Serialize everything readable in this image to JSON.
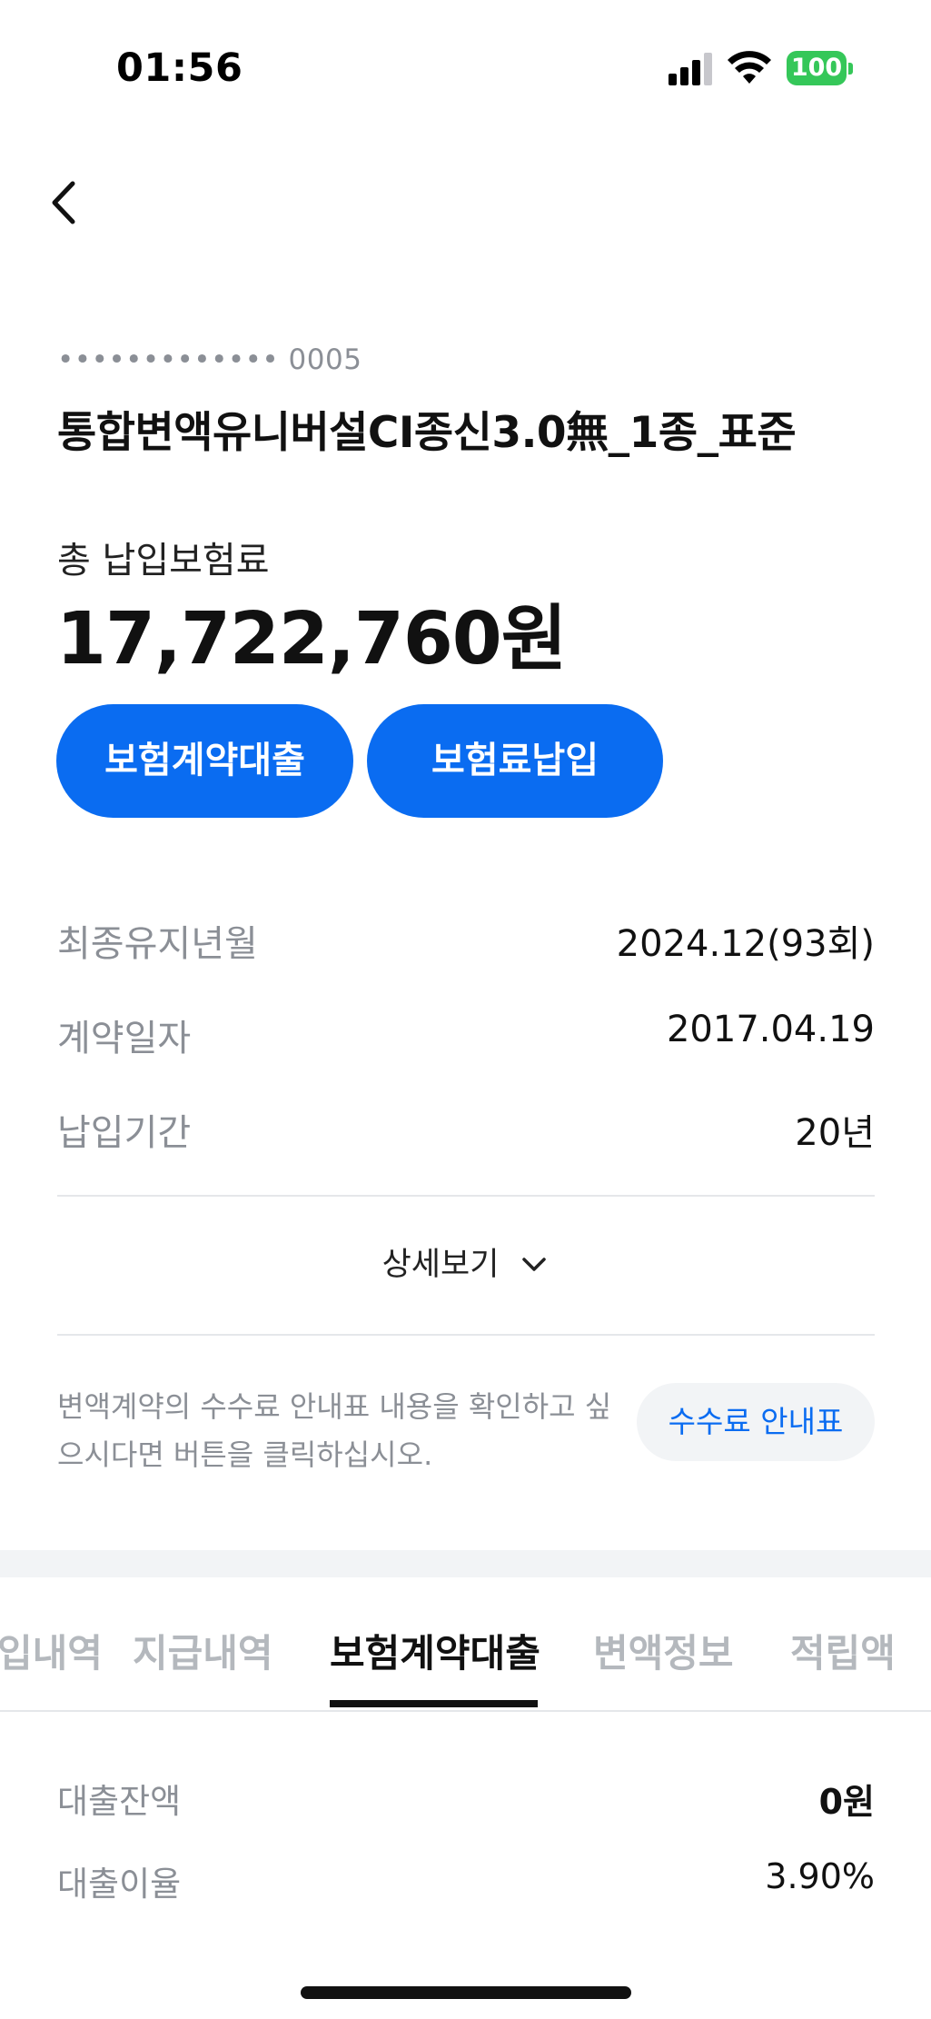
{
  "status_bar": {
    "time": "01:56",
    "battery": "100"
  },
  "header": {
    "back_icon": "chevron-left-icon"
  },
  "account": {
    "masked_number": "••••••••••••• 0005",
    "product_name": "통합변액유니버설CI종신3.0無_1종_표준",
    "total_label": "총 납입보험료",
    "total_amount": "17,722,760원"
  },
  "actions": {
    "loan_button": "보험계약대출",
    "pay_button": "보험료납입"
  },
  "info": [
    {
      "label": "최종유지년월",
      "value": "2024.12(93회)"
    },
    {
      "label": "계약일자",
      "value": "2017.04.19"
    },
    {
      "label": "납입기간",
      "value": "20년"
    }
  ],
  "detail_toggle": {
    "label": "상세보기",
    "icon": "chevron-down-icon"
  },
  "notice": {
    "text": "변액계약의 수수료 안내표 내용을 확인하고 싶으시다면 버튼을 클릭하십시오.",
    "button": "수수료 안내표"
  },
  "tabs": {
    "items": [
      "입내역",
      "지급내역",
      "보험계약대출",
      "변액정보",
      "적립액"
    ],
    "active_index": 2
  },
  "loan": {
    "rows": [
      {
        "label": "대출잔액",
        "value": "0원"
      },
      {
        "label": "대출이율",
        "value": "3.90%"
      }
    ]
  },
  "colors": {
    "accent": "#0a6cf1",
    "battery": "#35c759",
    "muted_text": "#8b8f96",
    "inactive_tab": "#b4b8bd"
  }
}
